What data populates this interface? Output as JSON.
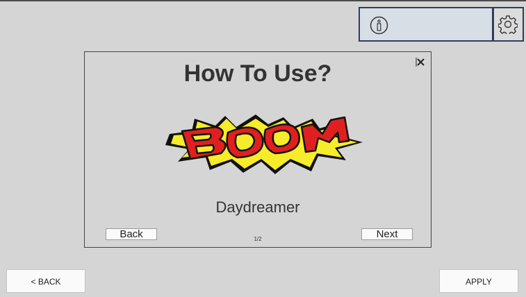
{
  "dialog": {
    "title": "How To Use?",
    "caption": "Daydreamer",
    "back_label": "Back",
    "next_label": "Next",
    "page_indicator": "1/2",
    "illustration_text": "BOOM"
  },
  "footer": {
    "back_label": "< BACK",
    "apply_label": "APPLY"
  },
  "icons": {
    "info": "info-icon",
    "settings": "gear-icon",
    "close": "close-icon"
  },
  "colors": {
    "background": "#d5d5d5",
    "panel_border": "#2c3e5c",
    "panel_fill": "#d8dee6",
    "title_text": "#333333",
    "burst_yellow": "#f6ec2a",
    "boom_red": "#e02020"
  }
}
